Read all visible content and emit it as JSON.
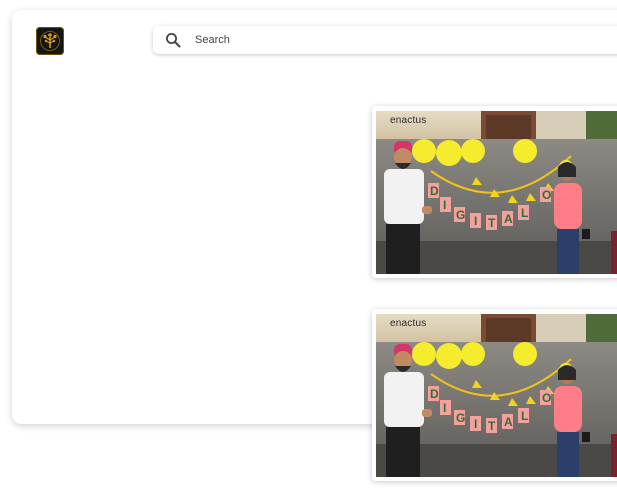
{
  "app": {
    "logo_icon": "tree-logo-icon"
  },
  "search": {
    "placeholder": "Search",
    "value": "",
    "icon": "search-icon"
  },
  "photos": [
    {
      "brand_text": "enactus"
    },
    {
      "brand_text": "enactus"
    }
  ],
  "colors": {
    "background": "#ffffff",
    "card": "#ffffff",
    "logo_bg": "#151515",
    "logo_gold": "#d89a1c"
  }
}
